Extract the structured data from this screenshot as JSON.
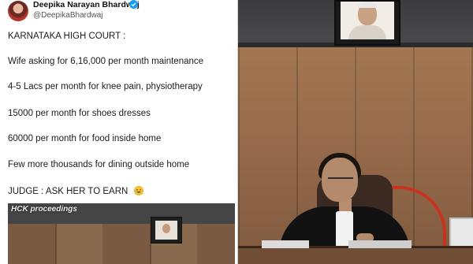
{
  "tweet": {
    "author_name": "Deepika Narayan Bhardwaj",
    "author_handle": "@DeepikaBhardwaj",
    "verified": true,
    "lines": [
      "KARNATAKA HIGH COURT :",
      "Wife asking for 6,16,000 per month maintenance",
      "4-5 Lacs per month for knee pain, physiotherapy",
      "15000 per month for shoes dresses",
      "60000 per month for food inside home",
      "Few more thousands for dining outside home",
      "JUDGE : ASK HER TO EARN"
    ],
    "last_line_emoji": "rolling-on-floor-laughing-emoji",
    "embed_caption": "HCK proceedings"
  },
  "colors": {
    "verified_blue": "#1d9bf0",
    "text": "#1b1b1b",
    "lamp_red": "#c8331f",
    "wood": "#94694a"
  }
}
